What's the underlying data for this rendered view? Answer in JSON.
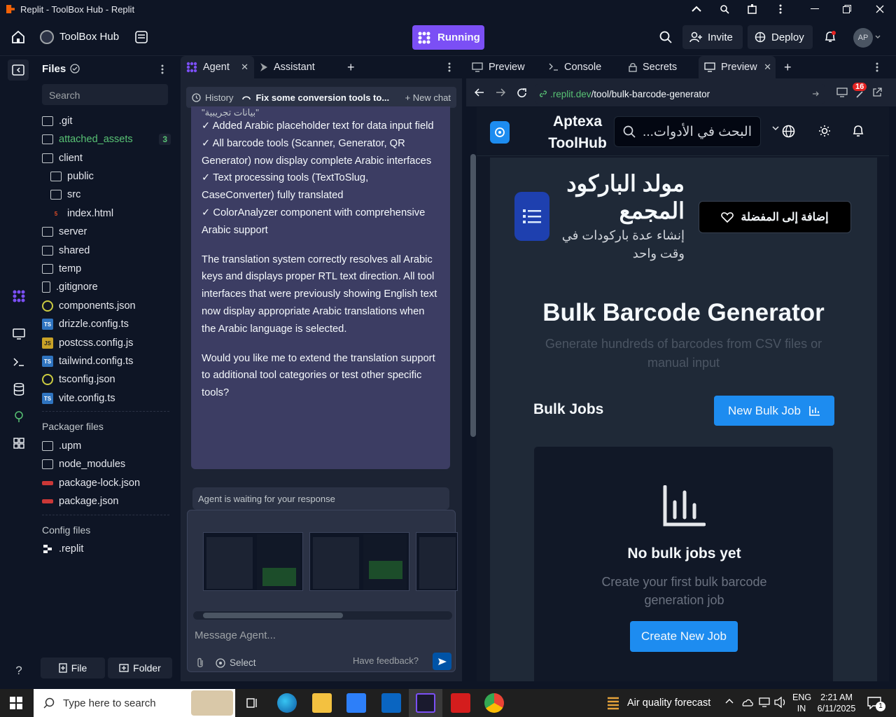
{
  "window": {
    "title": "Replit - ToolBox Hub - Replit"
  },
  "header": {
    "project_name": "ToolBox Hub",
    "run_status": "Running",
    "invite_label": "Invite",
    "deploy_label": "Deploy",
    "avatar_initials": "AP"
  },
  "files": {
    "title": "Files",
    "search_placeholder": "Search",
    "items": [
      {
        "name": ".git",
        "icon": "folder-icon"
      },
      {
        "name": "attached_assets",
        "icon": "folder-icon",
        "badge": "3"
      },
      {
        "name": "client",
        "icon": "folder-icon"
      },
      {
        "name": "public",
        "icon": "folder-icon"
      },
      {
        "name": "src",
        "icon": "folder-icon"
      },
      {
        "name": "index.html",
        "icon": "html-icon"
      },
      {
        "name": "server",
        "icon": "folder-icon"
      },
      {
        "name": "shared",
        "icon": "folder-icon"
      },
      {
        "name": "temp",
        "icon": "folder-icon"
      },
      {
        "name": ".gitignore",
        "icon": "file-icon"
      },
      {
        "name": "components.json",
        "icon": "json-icon"
      },
      {
        "name": "drizzle.config.ts",
        "icon": "ts-icon"
      },
      {
        "name": "postcss.config.js",
        "icon": "js-icon"
      },
      {
        "name": "tailwind.config.ts",
        "icon": "ts-icon"
      },
      {
        "name": "tsconfig.json",
        "icon": "json-icon"
      },
      {
        "name": "vite.config.ts",
        "icon": "ts-icon"
      }
    ],
    "packager_title": "Packager files",
    "packager_items": [
      {
        "name": ".upm",
        "icon": "folder-icon"
      },
      {
        "name": "node_modules",
        "icon": "folder-icon"
      },
      {
        "name": "package-lock.json",
        "icon": "npm-icon"
      },
      {
        "name": "package.json",
        "icon": "npm-icon"
      }
    ],
    "config_title": "Config files",
    "config_items": [
      {
        "name": ".replit",
        "icon": "replit-icon"
      }
    ],
    "new_file_label": "File",
    "new_folder_label": "Folder"
  },
  "agent": {
    "tabs": [
      {
        "label": "Agent"
      },
      {
        "label": "Assistant"
      }
    ],
    "history_label": "History",
    "chat_title": "Fix some conversion tools to...",
    "new_chat_label": "New chat",
    "message_top_fragment": "\"بيانات تجريبية\"",
    "message_lines": [
      "✓ Added Arabic placeholder text for data input field",
      "✓ All barcode tools (Scanner, Generator, QR Generator) now display complete Arabic interfaces",
      "✓ Text processing tools (TextToSlug, CaseConverter) fully translated",
      "✓ ColorAnalyzer component with comprehensive Arabic support"
    ],
    "paragraph_1": "The translation system correctly resolves all Arabic keys and displays proper RTL text direction. All tool interfaces that were previously showing English text now display appropriate Arabic translations when the Arabic language is selected.",
    "paragraph_2": "Would you like me to extend the translation support to additional tool categories or test other specific tools?",
    "waiting_text": "Agent is waiting for your response",
    "input_placeholder": "Message Agent...",
    "select_label": "Select",
    "feedback_label": "Have feedback?"
  },
  "preview": {
    "tabs": [
      {
        "label": "Preview"
      },
      {
        "label": "Console"
      },
      {
        "label": "Secrets"
      },
      {
        "label": "Preview"
      }
    ],
    "url_domain": ".replit.dev",
    "url_path": "/tool/bulk-barcode-generator",
    "notif_count": "16",
    "site": {
      "brand_line1": "Aptexa",
      "brand_line2": "ToolHub",
      "search_placeholder": "البحث في الأدوات...",
      "tool_title_ar_1": "مولد الباركود",
      "tool_title_ar_2": "المجمع",
      "tool_desc_ar_1": "إنشاء عدة باركودات في",
      "tool_desc_ar_2": "وقت واحد",
      "favorite_label": "إضافة إلى المفضلة",
      "heading": "Bulk Barcode Generator",
      "subheading": "Generate hundreds of barcodes from CSV files or manual input",
      "jobs_title": "Bulk Jobs",
      "new_job_label": "New Bulk Job",
      "empty_title": "No bulk jobs yet",
      "empty_desc": "Create your first bulk barcode generation job",
      "create_label": "Create New Job"
    }
  },
  "taskbar": {
    "search_placeholder": "Type here to search",
    "weather": "Air quality forecast",
    "lang_1": "ENG",
    "lang_2": "IN",
    "time": "2:21 AM",
    "date": "6/11/2025",
    "notif_count": "1"
  },
  "colors": {
    "accent": "#7b4ff5",
    "bg": "#0e1525",
    "panel": "#1c2333",
    "link": "#58c274",
    "site_button": "#1d8cf0"
  }
}
